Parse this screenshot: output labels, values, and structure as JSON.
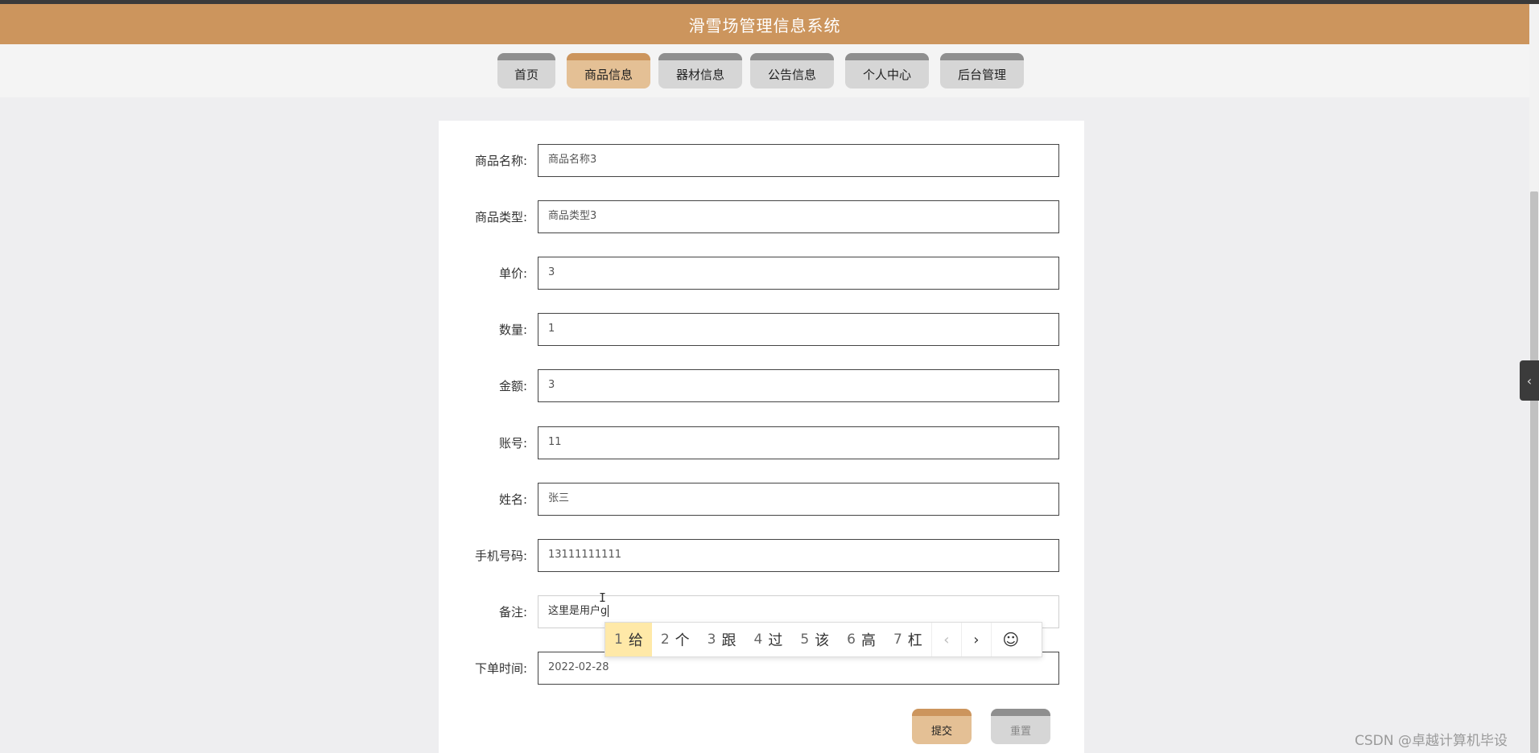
{
  "header": {
    "title": "滑雪场管理信息系统"
  },
  "nav": {
    "items": [
      {
        "label": "首页",
        "active": false
      },
      {
        "label": "商品信息",
        "active": true
      },
      {
        "label": "器材信息",
        "active": false
      },
      {
        "label": "公告信息",
        "active": false
      },
      {
        "label": "个人中心",
        "active": false
      },
      {
        "label": "后台管理",
        "active": false
      }
    ]
  },
  "form": {
    "fields": [
      {
        "label": "商品名称:",
        "value": "商品名称3"
      },
      {
        "label": "商品类型:",
        "value": "商品类型3"
      },
      {
        "label": "单价:",
        "value": "3"
      },
      {
        "label": "数量:",
        "value": "1"
      },
      {
        "label": "金额:",
        "value": "3"
      },
      {
        "label": "账号:",
        "value": "11"
      },
      {
        "label": "姓名:",
        "value": "张三"
      },
      {
        "label": "手机号码:",
        "value": "13111111111"
      },
      {
        "label": "备注:",
        "value": "这里是用户g"
      },
      {
        "label": "下单时间:",
        "value": "2022-02-28"
      }
    ],
    "submit_label": "提交",
    "reset_label": "重置"
  },
  "ime": {
    "candidates": [
      {
        "num": "1",
        "text": "给"
      },
      {
        "num": "2",
        "text": "个"
      },
      {
        "num": "3",
        "text": "跟"
      },
      {
        "num": "4",
        "text": "过"
      },
      {
        "num": "5",
        "text": "该"
      },
      {
        "num": "6",
        "text": "高"
      },
      {
        "num": "7",
        "text": "杠"
      }
    ],
    "prev_icon": "‹",
    "next_icon": "›",
    "emoji_icon": "☺"
  },
  "side_tab": {
    "icon": "‹"
  },
  "watermark": "CSDN @卓越计算机毕设",
  "colors": {
    "brand": "#cc955d",
    "active_tab": "#e4c095",
    "tab": "#d6d6d6",
    "tab_top": "#8f8f8f",
    "ime_selected": "#ffe9a8"
  }
}
